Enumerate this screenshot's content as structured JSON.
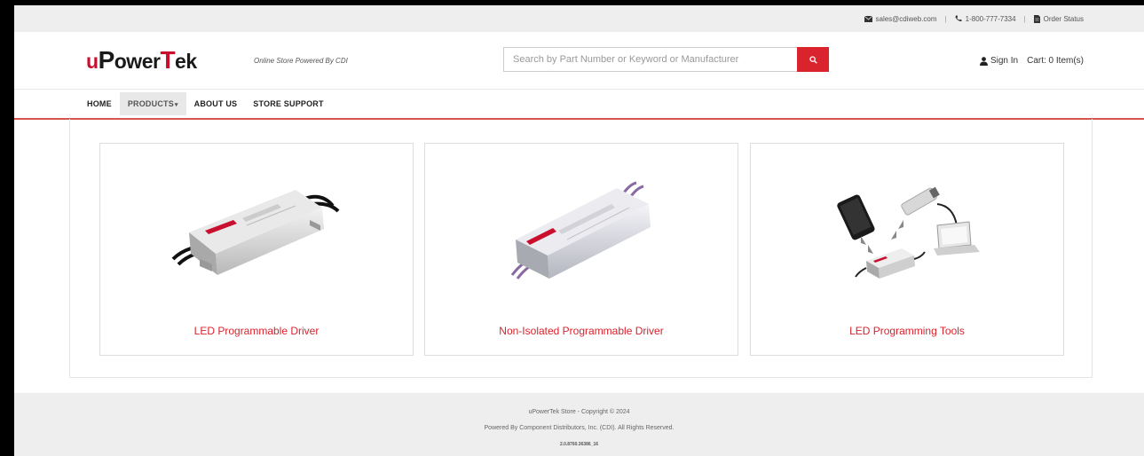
{
  "topbar": {
    "email": "sales@cdiweb.com",
    "phone": "1-800-777-7334",
    "order_status": "Order Status"
  },
  "header": {
    "logo_prefix": "u",
    "logo_p": "P",
    "logo_ower": "ower",
    "logo_t": "T",
    "logo_ek": "ek",
    "tagline": "Online Store Powered By CDI",
    "search_placeholder": "Search by Part Number or Keyword or Manufacturer",
    "sign_in": "Sign In",
    "cart": "Cart: 0 Item(s)"
  },
  "nav": {
    "items": [
      {
        "label": "HOME"
      },
      {
        "label": "PRODUCTS"
      },
      {
        "label": "ABOUT US"
      },
      {
        "label": "STORE SUPPORT"
      }
    ],
    "products_caret": "▾"
  },
  "products": [
    {
      "title": "LED Programmable Driver"
    },
    {
      "title": "Non-Isolated Programmable Driver"
    },
    {
      "title": "LED Programming Tools"
    }
  ],
  "footer": {
    "line1": "uPowerTek Store - Copyright © 2024",
    "line2": "Powered By Component Distributors, Inc. (CDI). All Rights Reserved.",
    "line3": "2.0.8760.36386_16"
  },
  "colors": {
    "accent": "#d9232d",
    "nav_border": "#d9534f",
    "bar_bg": "#eeeeee"
  }
}
